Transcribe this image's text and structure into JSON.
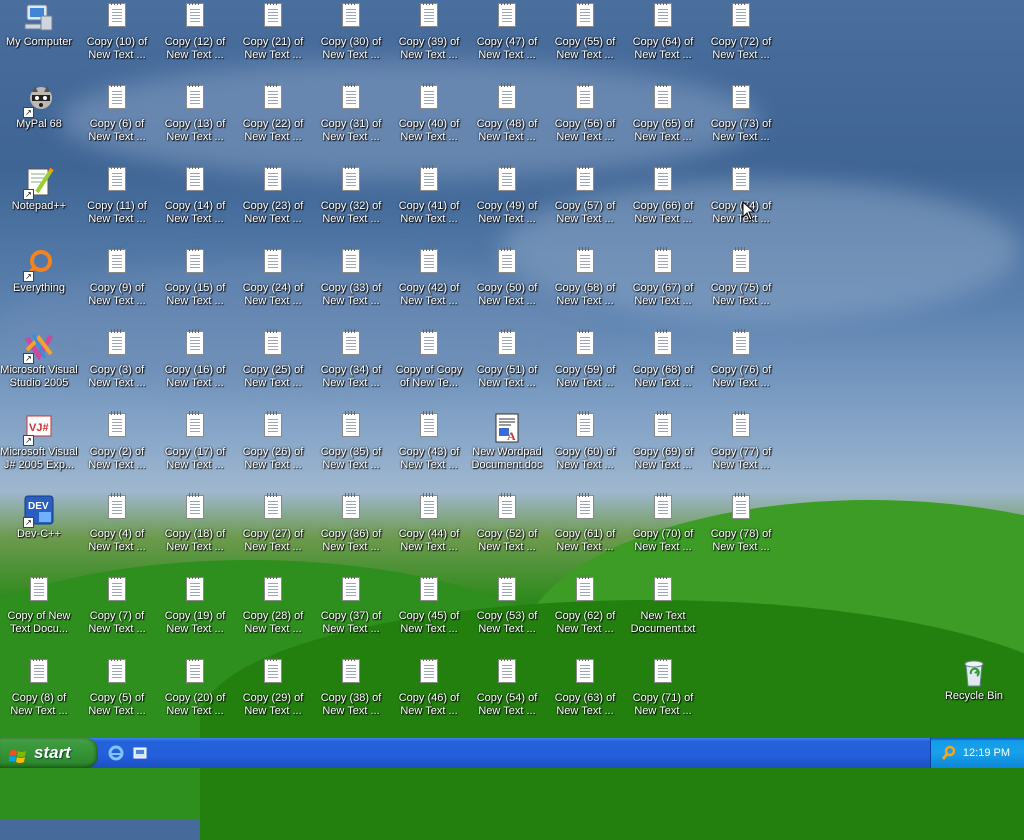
{
  "desktop": {
    "system_icons": [
      {
        "id": "my-computer",
        "label": "My Computer",
        "icon": "computer-icon"
      },
      {
        "id": "mypal",
        "label": "MyPal 68",
        "icon": "raccoon-icon",
        "shortcut": true
      },
      {
        "id": "notepadpp",
        "label": "Notepad++",
        "icon": "notepadpp-icon",
        "shortcut": true
      },
      {
        "id": "everything",
        "label": "Everything",
        "icon": "everything-icon",
        "shortcut": true
      },
      {
        "id": "msvs",
        "label": "Microsoft Visual Studio 2005",
        "icon": "visual-studio-icon",
        "shortcut": true
      },
      {
        "id": "msvj",
        "label": "Microsoft Visual J# 2005 Exp...",
        "icon": "vjsharp-icon",
        "shortcut": true
      },
      {
        "id": "devcpp",
        "label": "Dev-C++",
        "icon": "devcpp-icon",
        "shortcut": true
      },
      {
        "id": "copy-new-text",
        "label": "Copy of New Text Docu...",
        "icon": "text-document-icon"
      },
      {
        "id": "copy8",
        "label": "Copy (8) of New Text ...",
        "icon": "text-document-icon"
      }
    ],
    "grid_columns": [
      [
        "Copy (10) of New Text ...",
        "Copy (6) of New Text ...",
        "Copy (11) of New Text ...",
        "Copy (9) of New Text ...",
        "Copy (3) of New Text ...",
        "Copy (2) of New Text ...",
        "Copy (4) of New Text ...",
        "Copy (7) of New Text ...",
        "Copy (5) of New Text ..."
      ],
      [
        "Copy (12) of New Text ...",
        "Copy (13) of New Text ...",
        "Copy (14) of New Text ...",
        "Copy (15) of New Text ...",
        "Copy (16) of New Text ...",
        "Copy (17) of New Text ...",
        "Copy (18) of New Text ...",
        "Copy (19) of New Text ...",
        "Copy (20) of New Text ..."
      ],
      [
        "Copy (21) of New Text ...",
        "Copy (22) of New Text ...",
        "Copy (23) of New Text ...",
        "Copy (24) of New Text ...",
        "Copy (25) of New Text ...",
        "Copy (26) of New Text ...",
        "Copy (27) of New Text ...",
        "Copy (28) of New Text ...",
        "Copy (29) of New Text ..."
      ],
      [
        "Copy (30) of New Text ...",
        "Copy (31) of New Text ...",
        "Copy (32) of New Text ...",
        "Copy (33) of New Text ...",
        "Copy (34) of New Text ...",
        "Copy (35) of New Text ...",
        "Copy (36) of New Text ...",
        "Copy (37) of New Text ...",
        "Copy (38) of New Text ..."
      ],
      [
        "Copy (39) of New Text ...",
        "Copy (40) of New Text ...",
        "Copy (41) of New Text ...",
        "Copy (42) of New Text ...",
        "Copy of Copy of New Te...",
        "Copy (43) of New Text ...",
        "Copy (44) of New Text ...",
        "Copy (45) of New Text ...",
        "Copy (46) of New Text ..."
      ],
      [
        "Copy (47) of New Text ...",
        "Copy (48) of New Text ...",
        "Copy (49) of New Text ...",
        "Copy (50) of New Text ...",
        "Copy (51) of New Text ...",
        "New Wordpad Document.doc",
        "Copy (52) of New Text ...",
        "Copy (53) of New Text ...",
        "Copy (54) of New Text ..."
      ],
      [
        "Copy (55) of New Text ...",
        "Copy (56) of New Text ...",
        "Copy (57) of New Text ...",
        "Copy (58) of New Text ...",
        "Copy (59) of New Text ...",
        "Copy (60) of New Text ...",
        "Copy (61) of New Text ...",
        "Copy (62) of New Text ...",
        "Copy (63) of New Text ..."
      ],
      [
        "Copy (64) of New Text ...",
        "Copy (65) of New Text ...",
        "Copy (66) of New Text ...",
        "Copy (67) of New Text ...",
        "Copy (68) of New Text ...",
        "Copy (69) of New Text ...",
        "Copy (70) of New Text ...",
        "New Text Document.txt",
        "Copy (71) of New Text ..."
      ],
      [
        "Copy (72) of New Text ...",
        "Copy (73) of New Text ...",
        "Copy (74) of New Text ...",
        "Copy (75) of New Text ...",
        "Copy (76) of New Text ...",
        "Copy (77) of New Text ...",
        "Copy (78) of New Text ..."
      ]
    ],
    "recycle_bin": {
      "label": "Recycle Bin",
      "icon": "recycle-bin-icon"
    }
  },
  "taskbar": {
    "start_label": "start",
    "quick_launch": [
      {
        "name": "internet-explorer-icon"
      },
      {
        "name": "show-desktop-icon"
      }
    ],
    "tray_icon": "search-icon",
    "clock": "12:19 PM"
  },
  "colors": {
    "taskbar": "#245edb",
    "start": "#3c9a3c",
    "tray": "#18a0ea"
  }
}
